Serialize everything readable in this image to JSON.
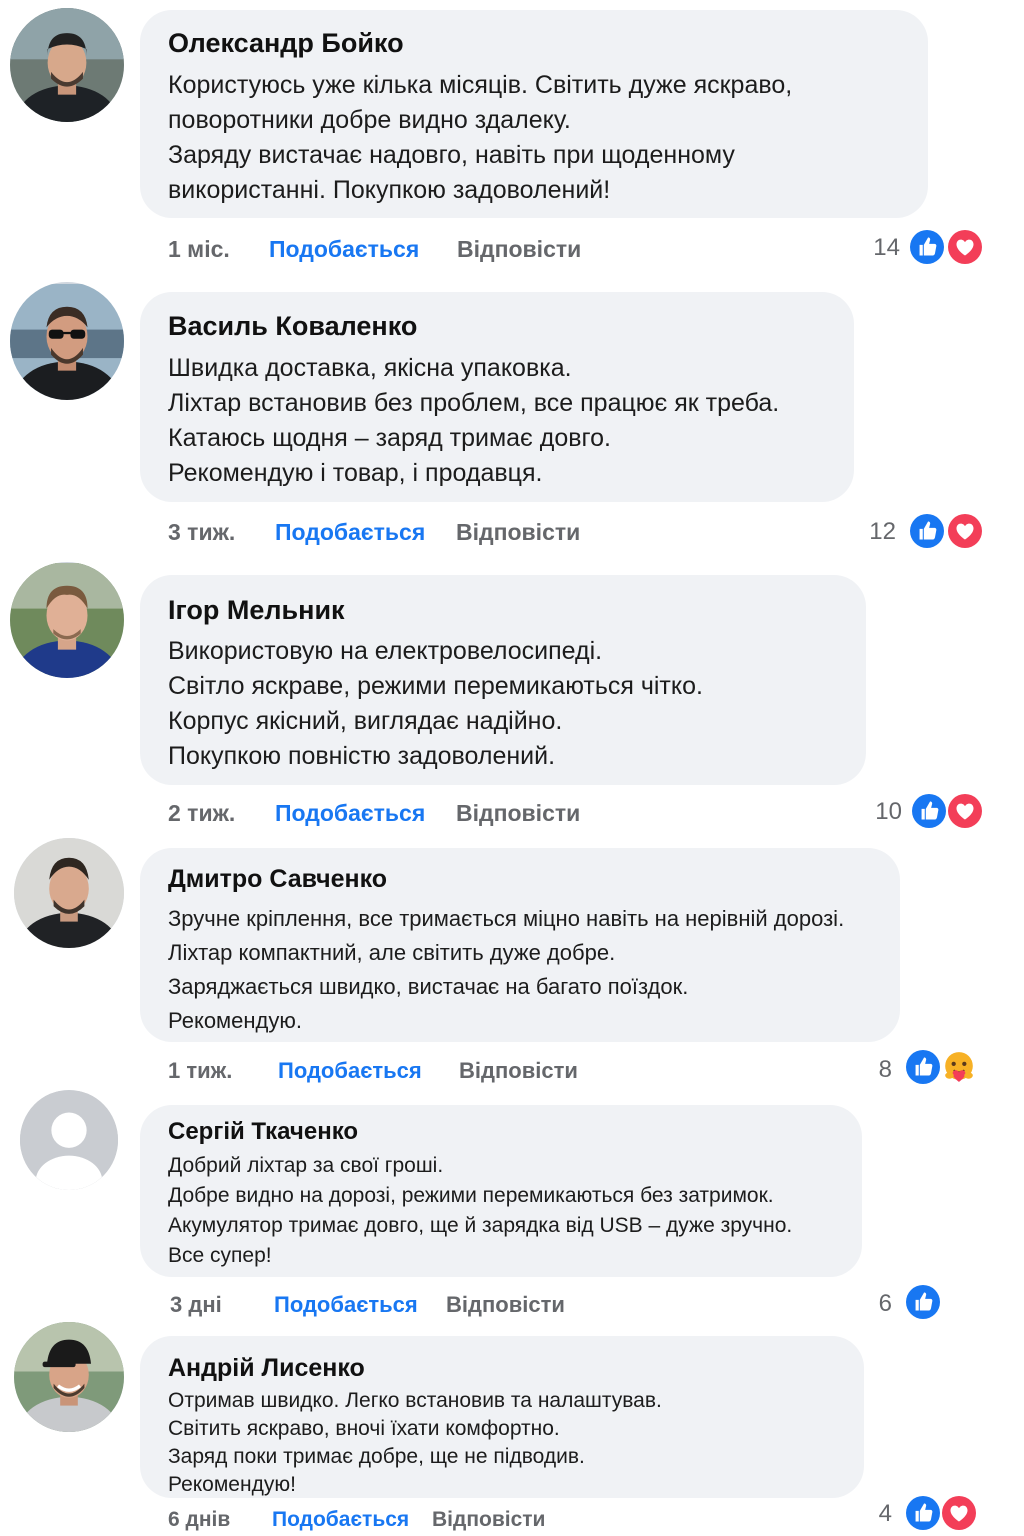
{
  "comments": [
    {
      "author": "Олександр Бойко",
      "lines": [
        "Користуюсь уже кілька місяців. Світить дуже яскраво,",
        "поворотники добре видно здалеку.",
        "Заряду вистачає надовго, навіть при щоденному",
        "використанні. Покупкою задоволений!"
      ],
      "time": "1 міс.",
      "like_label": "Подобається",
      "reply_label": "Відповісти",
      "reaction_count": "14",
      "reactions": [
        "like-icon",
        "love-icon"
      ]
    },
    {
      "author": "Василь Коваленко",
      "lines": [
        "Швидка доставка, якісна упаковка.",
        "Ліхтар встановив без проблем, все працює як треба.",
        "Катаюсь щодня – заряд тримає довго.",
        "Рекомендую і товар, і продавця."
      ],
      "time": "3 тиж.",
      "like_label": "Подобається",
      "reply_label": "Відповісти",
      "reaction_count": "12",
      "reactions": [
        "like-icon",
        "love-icon"
      ]
    },
    {
      "author": "Ігор Мельник",
      "lines": [
        "Використовую на електровелосипеді.",
        "Світло яскраве, режими перемикаються чітко.",
        "Корпус якісний, виглядає надійно.",
        "Покупкою повністю задоволений."
      ],
      "time": "2 тиж.",
      "like_label": "Подобається",
      "reply_label": "Відповісти",
      "reaction_count": "10",
      "reactions": [
        "like-icon",
        "love-icon"
      ]
    },
    {
      "author": "Дмитро Савченко",
      "lines": [
        "Зручне кріплення, все тримається міцно навіть на нерівній дорозі.",
        "Ліхтар компактний, але світить дуже добре.",
        "Заряджається швидко, вистачає на багато поїздок.",
        "Рекомендую."
      ],
      "time": "1 тиж.",
      "like_label": "Подобається",
      "reply_label": "Відповісти",
      "reaction_count": "8",
      "reactions": [
        "like-icon",
        "care-icon"
      ]
    },
    {
      "author": "Сергій Ткаченко",
      "lines": [
        "Добрий ліхтар за свої гроші.",
        "Добре видно на дорозі, режими перемикаються без затримок.",
        "Акумулятор тримає довго, ще й зарядка від USB – дуже зручно.",
        "Все супер!"
      ],
      "time": "3 дні",
      "like_label": "Подобається",
      "reply_label": "Відповісти",
      "reaction_count": "6",
      "reactions": [
        "like-icon"
      ]
    },
    {
      "author": "Андрій Лисенко",
      "lines": [
        "Отримав швидко. Легко встановив та налаштував.",
        "Світить яскраво, вночі їхати комфортно.",
        "Заряд поки тримає добре, ще не підводив.",
        "Рекомендую!"
      ],
      "time": "6 днів",
      "like_label": "Подобається",
      "reply_label": "Відповісти",
      "reaction_count": "4",
      "reactions": [
        "like-icon",
        "love-icon"
      ]
    }
  ],
  "colors": {
    "bubble": "#f0f2f5",
    "link_blue": "#1877f2",
    "meta_gray": "#65676b",
    "love_red": "#f33e58"
  }
}
